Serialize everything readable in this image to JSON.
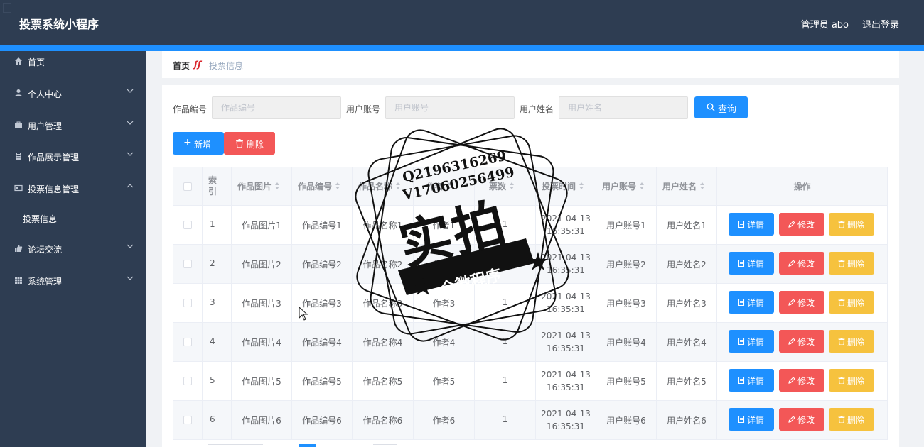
{
  "header": {
    "app_title": "投票系统小程序",
    "admin_label": "管理员 abo",
    "logout_label": "退出登录"
  },
  "sidebar": {
    "items": [
      {
        "label": "首页",
        "icon": "home-icon"
      },
      {
        "label": "个人中心",
        "icon": "user-icon"
      },
      {
        "label": "用户管理",
        "icon": "briefcase-icon"
      },
      {
        "label": "作品展示管理",
        "icon": "clipboard-icon"
      },
      {
        "label": "投票信息管理",
        "icon": "card-icon"
      },
      {
        "label": "论坛交流",
        "icon": "thumbs-up-icon"
      },
      {
        "label": "系统管理",
        "icon": "grid-icon"
      }
    ],
    "subitem": "投票信息"
  },
  "breadcrumb": {
    "home": "首页",
    "current": "投票信息"
  },
  "search": {
    "field1_label": "作品编号",
    "field1_placeholder": "作品编号",
    "field2_label": "用户账号",
    "field2_placeholder": "用户账号",
    "field3_label": "用户姓名",
    "field3_placeholder": "用户姓名",
    "query_label": "查询"
  },
  "toolbar": {
    "add_label": "新增",
    "delete_label": "删除"
  },
  "table": {
    "headers": [
      "索引",
      "作品图片",
      "作品编号",
      "作品名称",
      "作者",
      "票数",
      "投票时间",
      "用户账号",
      "用户姓名",
      "操作"
    ],
    "rows": [
      {
        "index": "1",
        "image": "作品图片1",
        "code": "作品编号1",
        "name": "作品名称1",
        "author": "作者1",
        "votes": "1",
        "date": "2021-04-13",
        "time": "16:35:31",
        "account": "用户账号1",
        "username": "用户姓名1"
      },
      {
        "index": "2",
        "image": "作品图片2",
        "code": "作品编号2",
        "name": "作品名称2",
        "author": "作者2",
        "votes": "1",
        "date": "2021-04-13",
        "time": "16:35:31",
        "account": "用户账号2",
        "username": "用户姓名2"
      },
      {
        "index": "3",
        "image": "作品图片3",
        "code": "作品编号3",
        "name": "作品名称3",
        "author": "作者3",
        "votes": "1",
        "date": "2021-04-13",
        "time": "16:35:31",
        "account": "用户账号3",
        "username": "用户姓名3"
      },
      {
        "index": "4",
        "image": "作品图片4",
        "code": "作品编号4",
        "name": "作品名称4",
        "author": "作者4",
        "votes": "1",
        "date": "2021-04-13",
        "time": "16:35:31",
        "account": "用户账号4",
        "username": "用户姓名4"
      },
      {
        "index": "5",
        "image": "作品图片5",
        "code": "作品编号5",
        "name": "作品名称5",
        "author": "作者5",
        "votes": "1",
        "date": "2021-04-13",
        "time": "16:35:31",
        "account": "用户账号5",
        "username": "用户姓名5"
      },
      {
        "index": "6",
        "image": "作品图片6",
        "code": "作品编号6",
        "name": "作品名称6",
        "author": "作者6",
        "votes": "1",
        "date": "2021-04-13",
        "time": "16:35:31",
        "account": "用户账号6",
        "username": "用户姓名6"
      }
    ],
    "actions": {
      "detail": "详情",
      "edit": "修改",
      "remove": "删除"
    }
  },
  "watermark": {
    "line1": "Q2196316269",
    "line2": "V17060256499",
    "big": "实拍",
    "sub": "全微程序"
  },
  "colors": {
    "header_bg": "#2e3d52",
    "accent": "#1e90ff",
    "danger": "#f35757",
    "warning": "#f6c23e"
  }
}
